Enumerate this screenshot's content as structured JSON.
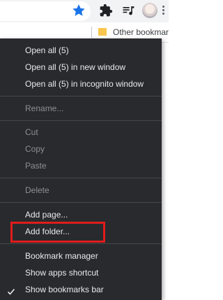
{
  "browser": {
    "bookmarks_bar": {
      "other_bookmarks_label": "Other bookmar"
    },
    "toolbar_icons": [
      "star-icon",
      "extensions-puzzle-icon",
      "media-queue-icon",
      "avatar",
      "kebab-menu-icon"
    ]
  },
  "menu": {
    "items": [
      {
        "label": "Open all (5)",
        "enabled": true
      },
      {
        "label": "Open all (5) in new window",
        "enabled": true
      },
      {
        "label": "Open all (5) in incognito window",
        "enabled": true
      },
      {
        "label": "Rename...",
        "enabled": false
      },
      {
        "label": "Cut",
        "enabled": false
      },
      {
        "label": "Copy",
        "enabled": false
      },
      {
        "label": "Paste",
        "enabled": false
      },
      {
        "label": "Delete",
        "enabled": false
      },
      {
        "label": "Add page...",
        "enabled": true
      },
      {
        "label": "Add folder...",
        "enabled": true,
        "highlighted": true
      },
      {
        "label": "Bookmark manager",
        "enabled": true
      },
      {
        "label": "Show apps shortcut",
        "enabled": true
      },
      {
        "label": "Show bookmarks bar",
        "enabled": true,
        "checked": true
      }
    ]
  },
  "colors": {
    "menu_background": "#292a2d",
    "menu_text": "#e8eaed",
    "menu_text_disabled": "#8e8f92",
    "highlight_border": "#e01c1c",
    "star_blue": "#1a73e8"
  }
}
